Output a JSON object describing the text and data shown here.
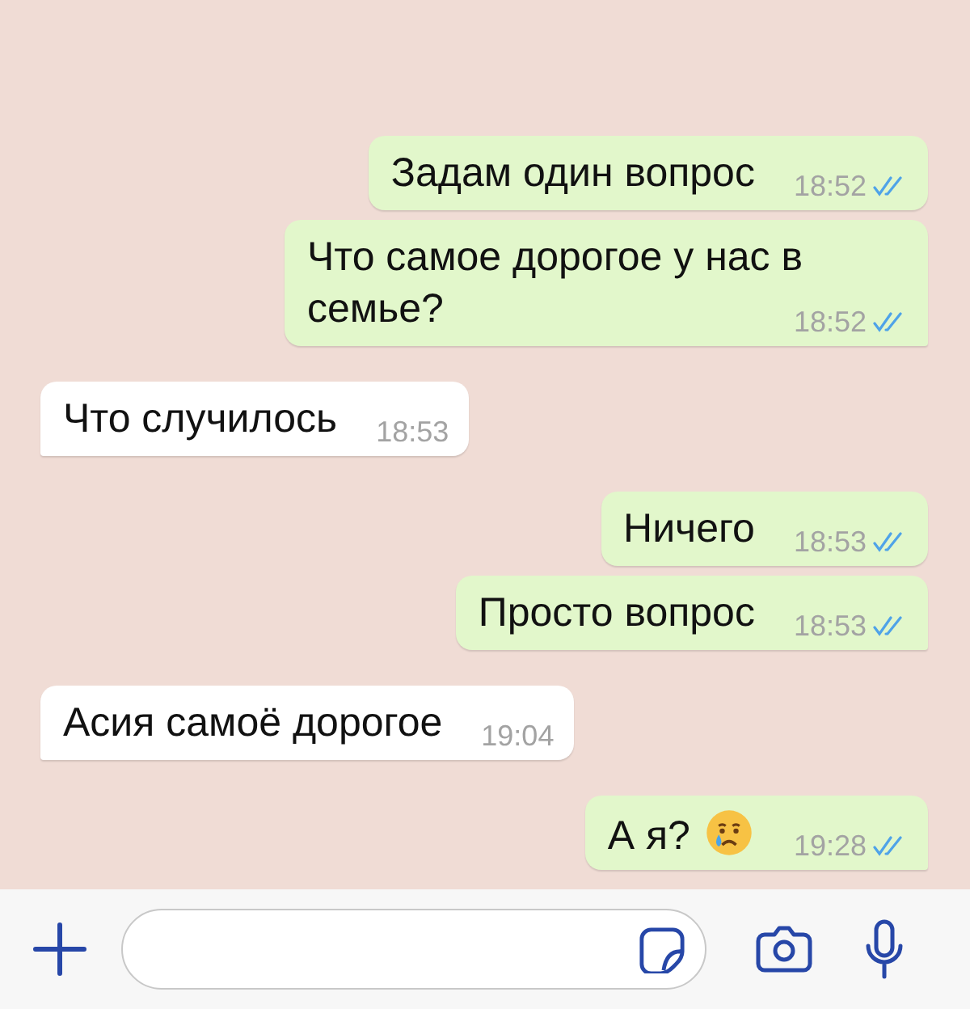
{
  "messages": [
    {
      "kind": "outgoing",
      "text": "Задам один вопрос",
      "time": "18:52",
      "read": true,
      "tail": false
    },
    {
      "kind": "outgoing",
      "text": "Что самое дорогое у нас в семье?",
      "time": "18:52",
      "read": true,
      "tail": true
    },
    {
      "kind": "incoming",
      "text": "Что случилось",
      "time": "18:53",
      "tail": true
    },
    {
      "kind": "outgoing",
      "text": "Ничего",
      "time": "18:53",
      "read": true,
      "tail": false
    },
    {
      "kind": "outgoing",
      "text": "Просто вопрос",
      "time": "18:53",
      "read": true,
      "tail": true
    },
    {
      "kind": "incoming",
      "text": "Асия самоё дорогое",
      "time": "19:04",
      "tail": true
    },
    {
      "kind": "outgoing",
      "text": "А я?",
      "crying_emoji": true,
      "time": "19:28",
      "read": true,
      "tail": true
    }
  ]
}
